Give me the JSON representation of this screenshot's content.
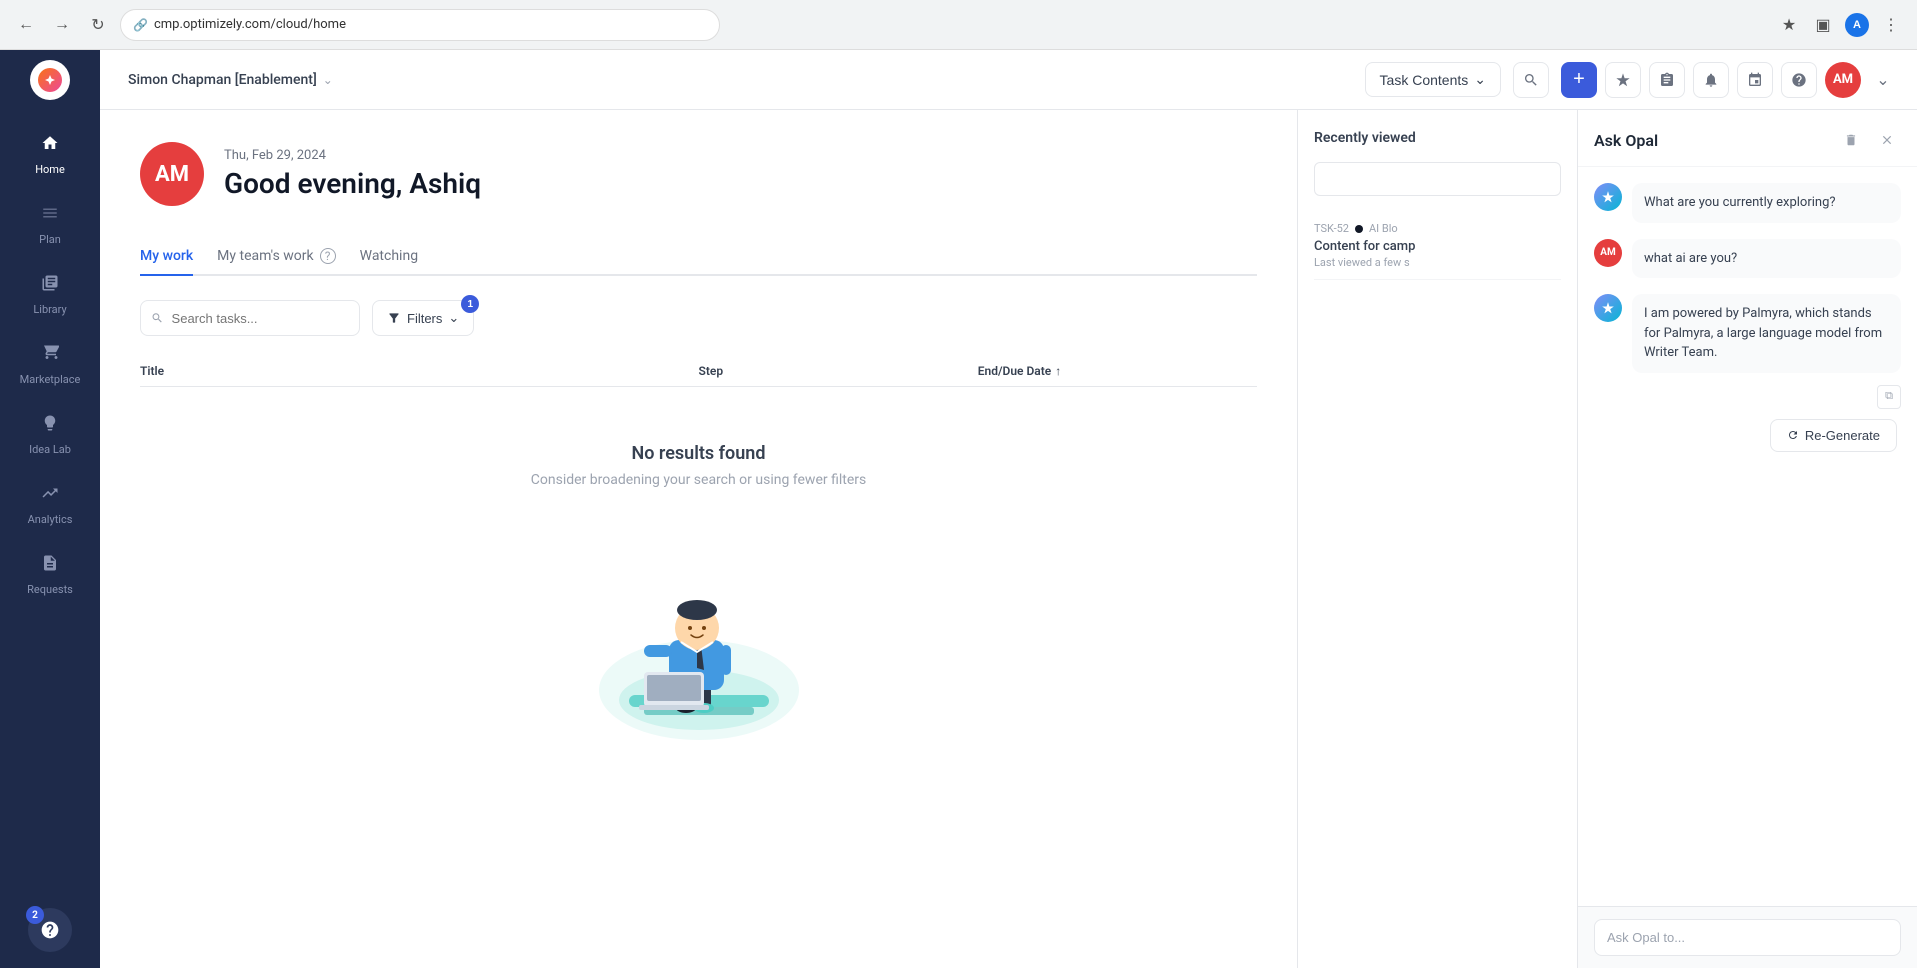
{
  "browser": {
    "url": "cmp.optimizely.com/cloud/home",
    "back_btn": "←",
    "forward_btn": "→",
    "refresh_btn": "↺",
    "avatar_initials": "A"
  },
  "header": {
    "workspace_name": "Simon Chapman [Enablement]",
    "task_contents_label": "Task Contents",
    "create_icon": "+",
    "ai_icon": "✦",
    "clipboard_icon": "📋",
    "bell_icon": "🔔",
    "calendar_icon": "📅",
    "help_icon": "?",
    "avatar_initials": "AM"
  },
  "sidebar": {
    "logo_text": "✦",
    "items": [
      {
        "id": "home",
        "label": "Home",
        "icon": "⌂",
        "active": true
      },
      {
        "id": "plan",
        "label": "Plan",
        "icon": "≡"
      },
      {
        "id": "library",
        "label": "Library",
        "icon": "⫿"
      },
      {
        "id": "marketplace",
        "label": "Marketplace",
        "icon": "⊞"
      },
      {
        "id": "idea-lab",
        "label": "Idea Lab",
        "icon": "💡"
      },
      {
        "id": "analytics",
        "label": "Analytics",
        "icon": "📈"
      },
      {
        "id": "requests",
        "label": "Requests",
        "icon": "📄"
      }
    ],
    "help_badge_count": "2",
    "help_icon": "?"
  },
  "home": {
    "greeting_date": "Thu, Feb 29, 2024",
    "greeting_text": "Good evening, Ashiq",
    "avatar_initials": "AM"
  },
  "tabs": [
    {
      "id": "my-work",
      "label": "My work",
      "active": true
    },
    {
      "id": "my-teams-work",
      "label": "My team's work"
    },
    {
      "id": "watching",
      "label": "Watching"
    }
  ],
  "filters": {
    "search_placeholder": "Search tasks...",
    "filter_label": "Filters",
    "filter_count": "1"
  },
  "table": {
    "col_title": "Title",
    "col_step": "Step",
    "col_date": "End/Due Date",
    "sort_icon": "↑"
  },
  "empty_state": {
    "title": "No results found",
    "subtitle": "Consider broadening your search or using fewer filters"
  },
  "recently_viewed": {
    "title": "Recently viewed",
    "search_placeholder": "",
    "items": [
      {
        "id": "TSK-52",
        "tag": "TSK-52",
        "category": "AI Blo",
        "title": "Content for camp",
        "time": "Last viewed a few s"
      }
    ]
  },
  "ask_opal": {
    "title": "Ask Opal",
    "messages": [
      {
        "type": "ai",
        "text": "What are you currently exploring?"
      },
      {
        "type": "user",
        "text": "what ai are you?",
        "avatar": "AM"
      },
      {
        "type": "ai",
        "text": "I am powered by Palmyra, which stands for Palmyra, a large language model from Writer Team.",
        "has_actions": true
      }
    ],
    "regenerate_label": "Re-Generate",
    "input_placeholder": "Ask Opal to...",
    "copy_icon": "⧉",
    "close_icon": "✕",
    "trash_icon": "🗑"
  }
}
